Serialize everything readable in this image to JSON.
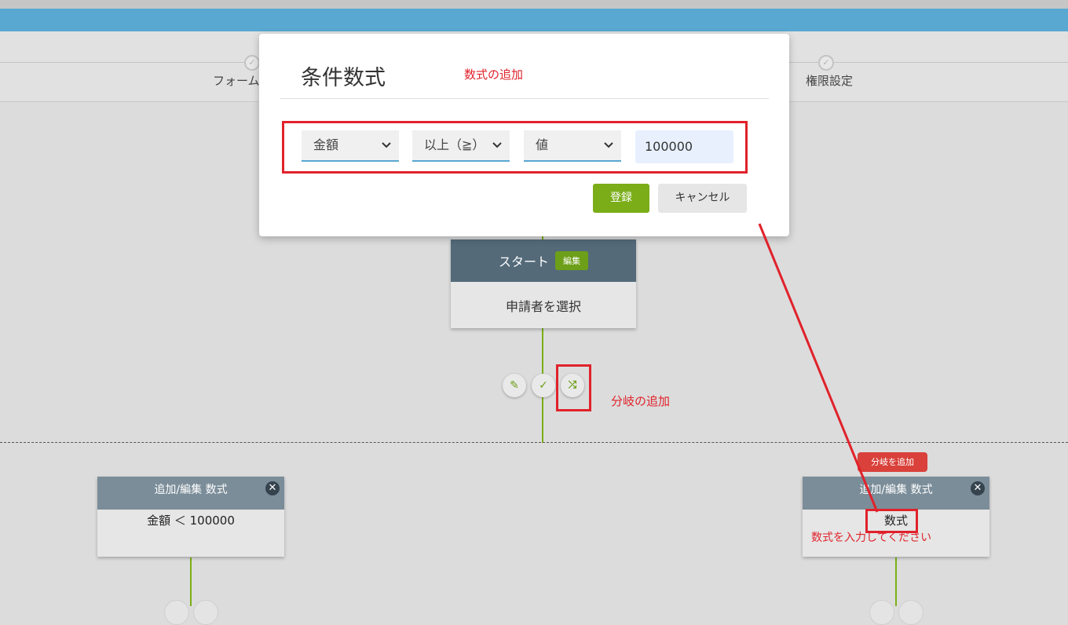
{
  "stepper": {
    "left_label": "フォーム",
    "right_label": "権限設定"
  },
  "modal": {
    "title": "条件数式",
    "annotation": "数式の追加",
    "field_select": "金額",
    "operator_select": "以上（≧）",
    "type_select": "値",
    "value_input": "100000",
    "save_label": "登録",
    "cancel_label": "キャンセル"
  },
  "start_node": {
    "title": "スタート",
    "edit_badge": "編集",
    "body": "申請者を選択"
  },
  "branch_annotation": "分岐の追加",
  "left_condition": {
    "title": "追加/編集 数式",
    "formula": "金額 ＜ 100000"
  },
  "right_condition": {
    "add_branch_label": "分岐を追加",
    "title": "追加/編集 数式",
    "formula": "数式",
    "hint": "数式を入力してください"
  },
  "colors": {
    "accent_blue": "#59a8d1",
    "green": "#7aad18",
    "annotation_red": "#e0222b",
    "card_header": "#546a79"
  }
}
